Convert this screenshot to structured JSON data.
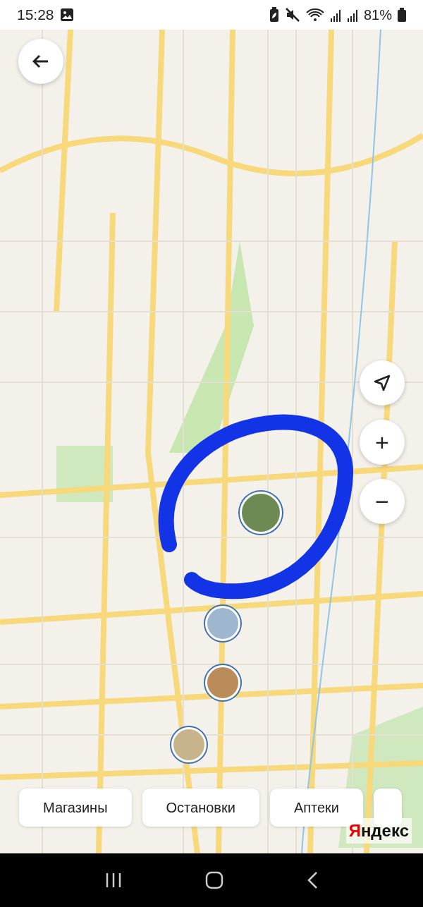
{
  "status_bar": {
    "time": "15:28",
    "battery": "81%"
  },
  "map": {
    "logo": "Яндекс",
    "zoom_in": "+",
    "zoom_out": "−"
  },
  "chips": [
    {
      "label": "Магазины"
    },
    {
      "label": "Остановки"
    },
    {
      "label": "Аптеки"
    }
  ]
}
